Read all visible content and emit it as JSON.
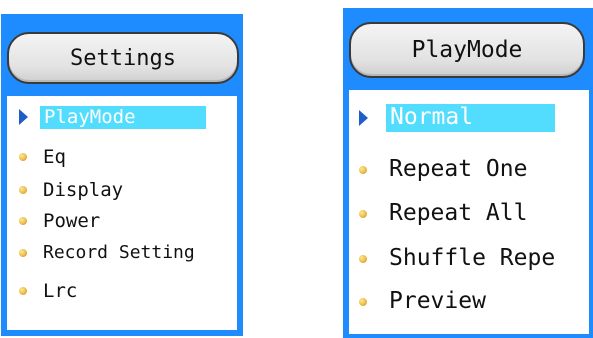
{
  "left_screen": {
    "title": "Settings",
    "menu": [
      {
        "label": "PlayMode",
        "selected": true,
        "marker": "arrow-icon"
      },
      {
        "label": "Eq",
        "selected": false,
        "marker": "dot-icon"
      },
      {
        "label": "Display",
        "selected": false,
        "marker": "dot-icon"
      },
      {
        "label": "Power",
        "selected": false,
        "marker": "dot-icon"
      },
      {
        "label": "Record Setting",
        "selected": false,
        "marker": "dot-icon"
      },
      {
        "label": "Lrc",
        "selected": false,
        "marker": "dot-icon"
      }
    ]
  },
  "right_screen": {
    "title": "PlayMode",
    "menu": [
      {
        "label": "Normal",
        "selected": true,
        "marker": "arrow-icon"
      },
      {
        "label": "Repeat One",
        "selected": false,
        "marker": "dot-icon"
      },
      {
        "label": "Repeat All",
        "selected": false,
        "marker": "dot-icon"
      },
      {
        "label": "Shuffle Repe",
        "selected": false,
        "marker": "dot-icon"
      },
      {
        "label": "Preview",
        "selected": false,
        "marker": "dot-icon"
      }
    ]
  },
  "colors": {
    "frame": "#1e8cff",
    "highlight": "#52ddff",
    "selector_arrow": "#1f5ec9",
    "bullet": "#e8b64a"
  }
}
